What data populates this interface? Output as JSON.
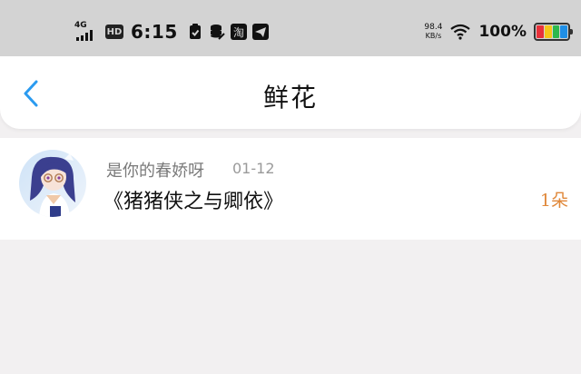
{
  "status_bar": {
    "network": "4G",
    "hd": "HD",
    "time": "6:15",
    "icons": [
      "check-shield-icon",
      "database-icon",
      "taobao-icon",
      "telegram-icon"
    ],
    "taobao_char": "淘",
    "speed_value": "98.4",
    "speed_unit": "KB/s",
    "battery_percent": "100%",
    "battery_colors": [
      "#e8313a",
      "#f5c518",
      "#2db84d",
      "#1f8fe6"
    ]
  },
  "header": {
    "title": "鲜花",
    "back_icon": "chevron-left-icon",
    "accent": "#2b9bf0"
  },
  "gift_list": [
    {
      "user": "是你的春娇呀",
      "date": "01-12",
      "book": "《猪猪侠之与卿依》",
      "count": "1朵"
    }
  ]
}
